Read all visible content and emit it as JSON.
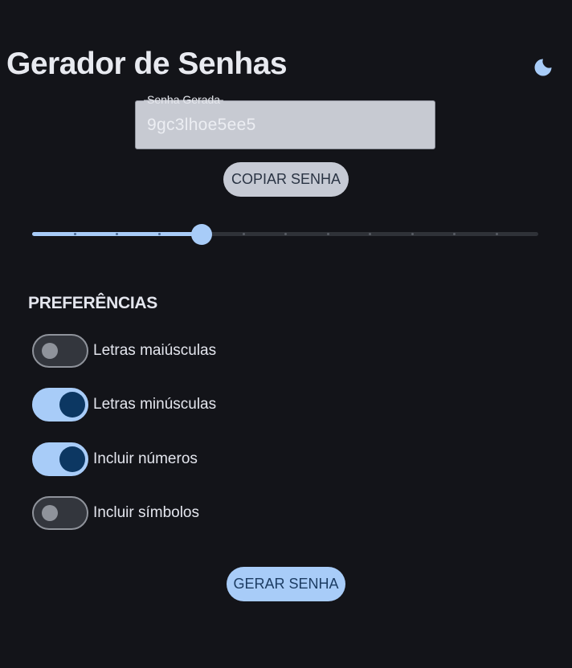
{
  "header": {
    "title": "Gerador de Senhas",
    "theme_icon": "moon-icon"
  },
  "password": {
    "label": "Senha Gerada",
    "value": "9gc3lhoe5ee5"
  },
  "buttons": {
    "copy": "COPIAR SENHA",
    "generate": "GERAR SENHA"
  },
  "slider": {
    "value": 4,
    "min": 0,
    "max": 12,
    "steps": 12
  },
  "preferences": {
    "title": "PREFERÊNCIAS",
    "items": [
      {
        "label": "Letras maiúsculas",
        "checked": false
      },
      {
        "label": "Letras minúsculas",
        "checked": true
      },
      {
        "label": "Incluir números",
        "checked": true
      },
      {
        "label": "Incluir símbolos",
        "checked": false
      }
    ]
  },
  "colors": {
    "background": "#131419",
    "accent": "#a8ccf8",
    "accent_dark": "#0c3762",
    "field_bg": "#c7cad2"
  }
}
